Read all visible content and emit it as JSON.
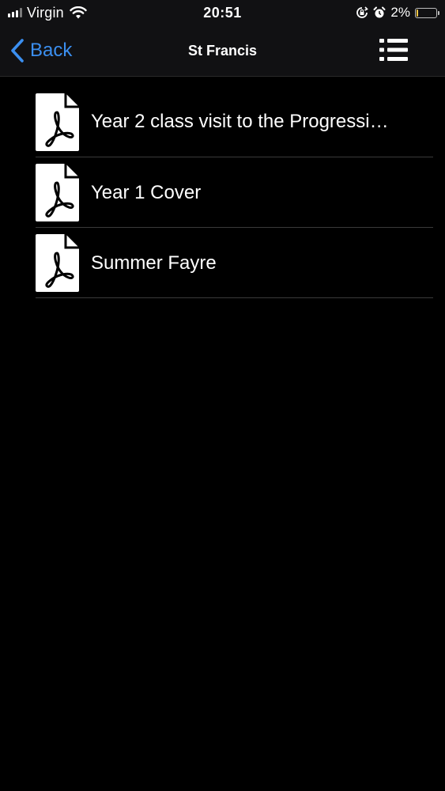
{
  "status_bar": {
    "carrier": "Virgin",
    "time": "20:51",
    "battery_percent": "2%",
    "battery_level": 0.02,
    "icons": [
      "signal-icon",
      "wifi-icon",
      "orientation-lock-icon",
      "alarm-icon",
      "battery-icon"
    ]
  },
  "nav": {
    "back_label": "Back",
    "title": "St Francis",
    "back_color": "#3b8ff0",
    "menu_icon": "list-menu-icon"
  },
  "documents": {
    "icon": "pdf-file-icon",
    "items": [
      {
        "label": "Year 2 class visit to the Progressi…"
      },
      {
        "label": "Year 1 Cover"
      },
      {
        "label": "Summer Fayre"
      }
    ]
  }
}
